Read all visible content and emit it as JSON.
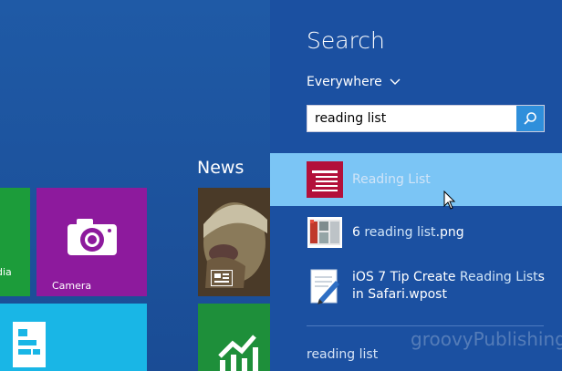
{
  "start_screen": {
    "news_heading": "News",
    "tiles": {
      "left_partial_label": "dia",
      "camera_label": "Camera"
    }
  },
  "search_pane": {
    "title": "Search",
    "scope": "Everywhere",
    "query": "reading list",
    "results": [
      {
        "prefix": "",
        "highlight": "Reading List",
        "suffix": "",
        "icon": "reading-list-app-icon"
      },
      {
        "prefix": "6 ",
        "highlight": "reading list",
        "suffix": ".png",
        "icon": "image-file-icon"
      },
      {
        "prefix": "iOS 7 Tip Create ",
        "highlight": "Reading List",
        "suffix": "s in Safari.wpost",
        "icon": "document-file-icon"
      }
    ],
    "suggestion": "reading list"
  },
  "watermark": "groovyPublishing",
  "colors": {
    "pane_bg": "#1b50a1",
    "selected_bg": "#7bc5f5",
    "camera_tile": "#8d1a9d",
    "green_tile": "#1c9c3a",
    "cyan_tile": "#19b6e6",
    "search_button": "#2f8fdb"
  }
}
